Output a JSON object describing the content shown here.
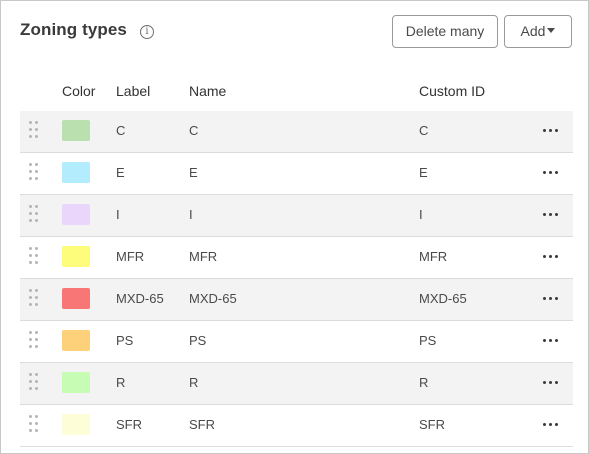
{
  "panel": {
    "title": "Zoning types",
    "info_icon": "info-circle-icon",
    "delete_many_label": "Delete many",
    "add_label": "Add"
  },
  "table": {
    "headers": {
      "color": "Color",
      "label": "Label",
      "name": "Name",
      "custom_id": "Custom ID"
    },
    "rows": [
      {
        "color": "#b9e0ae",
        "label": "C",
        "name": "C",
        "custom_id": "C"
      },
      {
        "color": "#b3ecfc",
        "label": "E",
        "name": "E",
        "custom_id": "E"
      },
      {
        "color": "#e9d6fa",
        "label": "I",
        "name": "I",
        "custom_id": "I"
      },
      {
        "color": "#fdfd7b",
        "label": "MFR",
        "name": "MFR",
        "custom_id": "MFR"
      },
      {
        "color": "#f87676",
        "label": "MXD-65",
        "name": "MXD-65",
        "custom_id": "MXD-65"
      },
      {
        "color": "#fdd17a",
        "label": "PS",
        "name": "PS",
        "custom_id": "PS"
      },
      {
        "color": "#c7fcb5",
        "label": "R",
        "name": "R",
        "custom_id": "R"
      },
      {
        "color": "#fdfdd8",
        "label": "SFR",
        "name": "SFR",
        "custom_id": "SFR"
      }
    ]
  }
}
